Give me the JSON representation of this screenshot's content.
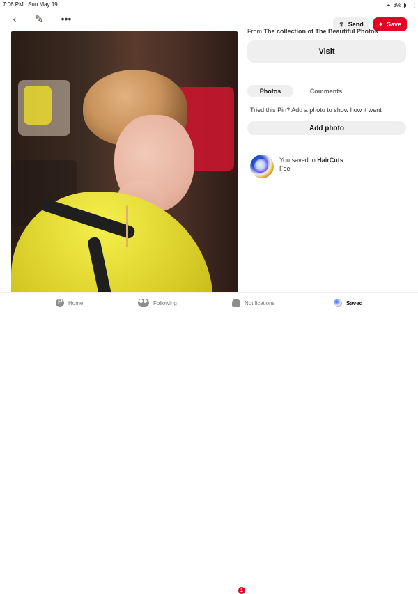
{
  "status_bar": {
    "time": "7:06 PM",
    "date": "Sun May 19",
    "battery": "3%",
    "battery_level": 3,
    "wifi_icon": "wifi-icon",
    "battery_icon": "battery-icon"
  },
  "toolbar": {
    "back_icon": "back-icon",
    "edit_icon": "edit-icon",
    "more_icon": "more-icon",
    "send_label": "Send",
    "save_label": "Save",
    "accent": "#e60023"
  },
  "pin_details": {
    "from_prefix": "From",
    "from_source": "The collection of The Beautiful Photos",
    "visit_label": "Visit"
  },
  "tabs": [
    {
      "label": "Photos",
      "selected": true
    },
    {
      "label": "Comments",
      "selected": false
    }
  ],
  "tried": {
    "prompt": "Tried this Pin? Add a photo to show how it went",
    "button_label": "Add photo"
  },
  "saved": {
    "line1_prefix": "You saved to ",
    "board": "HairCuts",
    "line2": "Feel"
  },
  "bottom_nav": {
    "home": "Home",
    "following": "Following",
    "notifications": "Notifications",
    "notifications_badge": "1",
    "saved": "Saved"
  },
  "photo": {
    "fullscreen_icon": "fullscreen-icon"
  }
}
